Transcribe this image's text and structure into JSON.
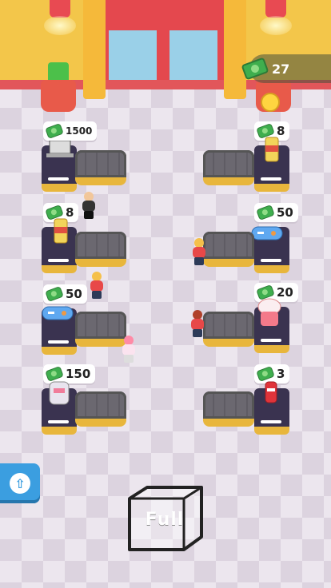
{
  "hud": {
    "money": "27",
    "money_icon": "cash-icon",
    "emotion_icon": "smiley-face-icon"
  },
  "stations": [
    {
      "id": "laptop",
      "price": "1500",
      "item_icon": "laptop-icon"
    },
    {
      "id": "chips",
      "price": "8",
      "item_icon": "chips-can-icon"
    },
    {
      "id": "chips-left",
      "price": "8",
      "item_icon": "chips-can-icon"
    },
    {
      "id": "gamepad-right",
      "price": "50",
      "item_icon": "gamepad-icon"
    },
    {
      "id": "gamepad-left",
      "price": "50",
      "item_icon": "gamepad-icon"
    },
    {
      "id": "ice-cream",
      "price": "20",
      "item_icon": "ice-cream-icon"
    },
    {
      "id": "rice-cooker",
      "price": "150",
      "item_icon": "rice-cooker-icon"
    },
    {
      "id": "soda",
      "price": "3",
      "item_icon": "soda-can-icon"
    }
  ],
  "storage": {
    "label": "Full"
  },
  "upgrade": {
    "icon": "upload-arrow-icon"
  },
  "colors": {
    "wall": "#f3c64a",
    "accent_red": "#e4484e",
    "cash_green": "#3fae4e",
    "button_blue": "#3b9ee0"
  }
}
